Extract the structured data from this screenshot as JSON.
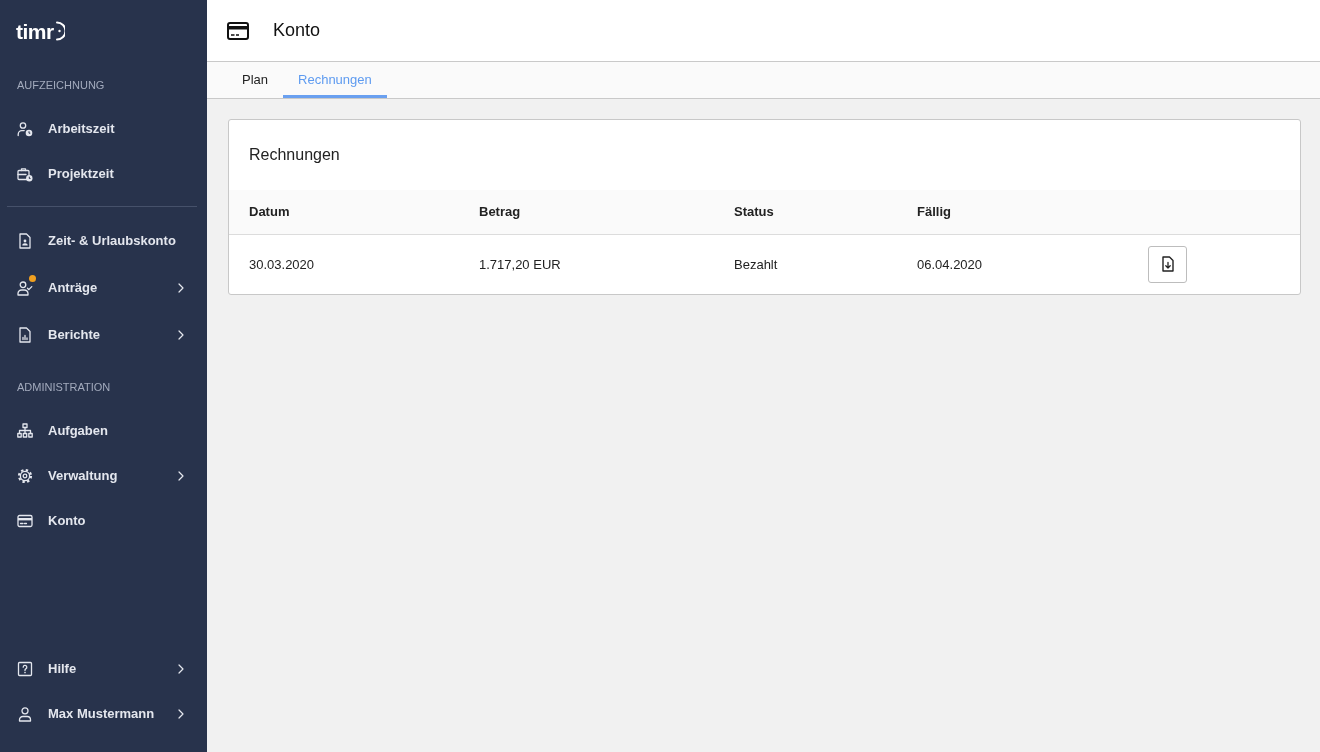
{
  "sidebar": {
    "logo": "timr",
    "sections": [
      {
        "heading": "AUFZEICHNUNG",
        "items": [
          {
            "label": "Arbeitszeit",
            "submenu": false,
            "notification": false
          },
          {
            "label": "Projektzeit",
            "submenu": false,
            "notification": false
          }
        ]
      },
      {
        "items": [
          {
            "label": "Zeit- & Urlaubskonto",
            "submenu": false,
            "notification": false
          },
          {
            "label": "Anträge",
            "submenu": true,
            "notification": true
          },
          {
            "label": "Berichte",
            "submenu": true,
            "notification": false
          }
        ]
      },
      {
        "heading": "ADMINISTRATION",
        "items": [
          {
            "label": "Aufgaben",
            "submenu": false,
            "notification": false
          },
          {
            "label": "Verwaltung",
            "submenu": true,
            "notification": false
          },
          {
            "label": "Konto",
            "submenu": false,
            "notification": false
          }
        ]
      }
    ],
    "footer_items": [
      {
        "label": "Hilfe",
        "submenu": true,
        "notification": false
      },
      {
        "label": "Max Mustermann",
        "submenu": true,
        "notification": false
      }
    ]
  },
  "header": {
    "title": "Konto"
  },
  "tabs": [
    {
      "label": "Plan",
      "selected": false
    },
    {
      "label": "Rechnungen",
      "selected": true
    }
  ],
  "invoices": {
    "title": "Rechnungen",
    "columns": [
      "Datum",
      "Betrag",
      "Status",
      "Fällig"
    ],
    "rows": [
      {
        "cells": [
          "30.03.2020",
          "1.717,20 EUR",
          "Bezahlt",
          "06.04.2020"
        ]
      }
    ]
  }
}
